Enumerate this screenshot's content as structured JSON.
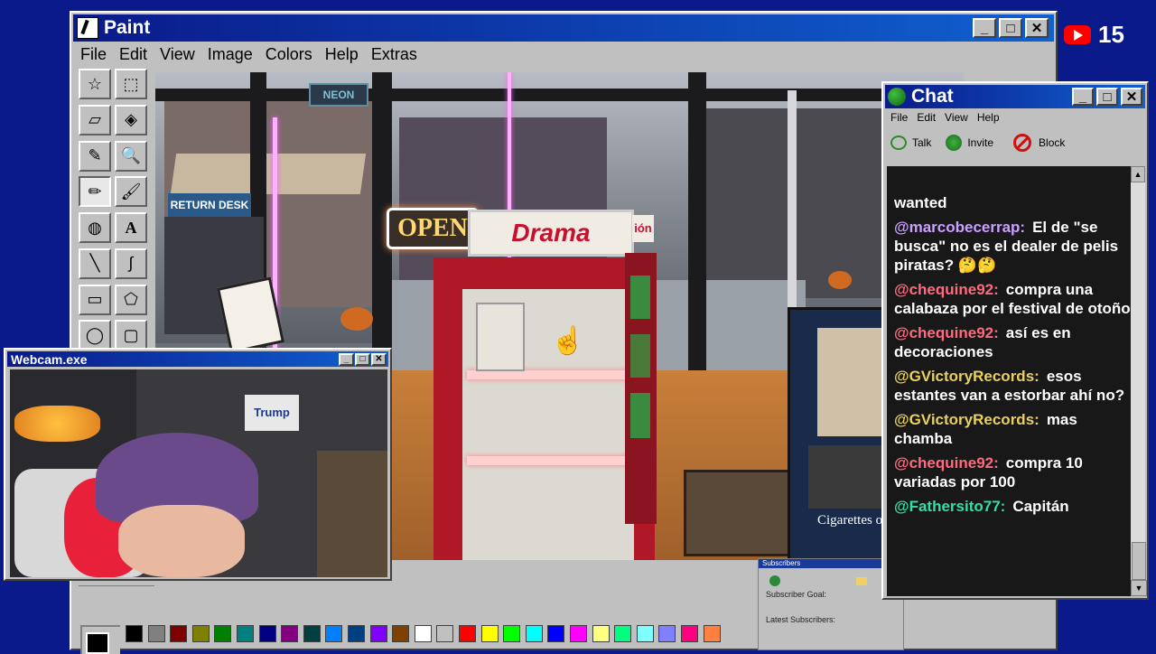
{
  "badge": {
    "count": "15"
  },
  "paint": {
    "title": "Paint",
    "menu": [
      "File",
      "Edit",
      "View",
      "Image",
      "Colors",
      "Help",
      "Extras"
    ],
    "scene": {
      "open_sign": "OPEN",
      "shelf_sign": "Drama",
      "return_desk": "RETURN DESK",
      "neon": "NEON",
      "corner_sign": "ión",
      "poster": "Cigarettes of Tune"
    },
    "palette": [
      "#000000",
      "#808080",
      "#800000",
      "#808000",
      "#008000",
      "#008080",
      "#000080",
      "#800080",
      "#004040",
      "#0080ff",
      "#004080",
      "#8000ff",
      "#804000",
      "#ffffff",
      "#c0c0c0",
      "#ff0000",
      "#ffff00",
      "#00ff00",
      "#00ffff",
      "#0000ff",
      "#ff00ff",
      "#ffff80",
      "#00ff80",
      "#80ffff",
      "#8080ff",
      "#ff0080",
      "#ff8040"
    ]
  },
  "webcam": {
    "title": "Webcam.exe",
    "poster": "Trump"
  },
  "chat": {
    "title": "Chat",
    "menu": [
      "File",
      "Edit",
      "View",
      "Help"
    ],
    "toolbar": {
      "talk": "Talk",
      "invite": "Invite",
      "block": "Block"
    },
    "top_fragment": "wanted",
    "messages": [
      {
        "user": "@marcobecerrap:",
        "color": "#c9a0ff",
        "text": "El de \"se busca\" no es el dealer de pelis piratas? 🤔🤔"
      },
      {
        "user": "@chequine92:",
        "color": "#ff6a7d",
        "text": "compra una calabaza por el festival de otoño"
      },
      {
        "user": "@chequine92:",
        "color": "#ff6a7d",
        "text": "así es en decoraciones"
      },
      {
        "user": "@GVictoryRecords:",
        "color": "#e8d060",
        "text": "esos estantes van a estorbar ahí no?"
      },
      {
        "user": "@GVictoryRecords:",
        "color": "#e8d060",
        "text": "mas chamba"
      },
      {
        "user": "@chequine92:",
        "color": "#ff6a7d",
        "text": "compra 10 variadas por 100"
      },
      {
        "user": "@Fathersito77:",
        "color": "#30e0a0",
        "text": "Capitán"
      }
    ]
  },
  "subscribers": {
    "title": "Subscribers",
    "goal_label": "Subscriber Goal:",
    "latest_label": "Latest Subscribers:"
  }
}
